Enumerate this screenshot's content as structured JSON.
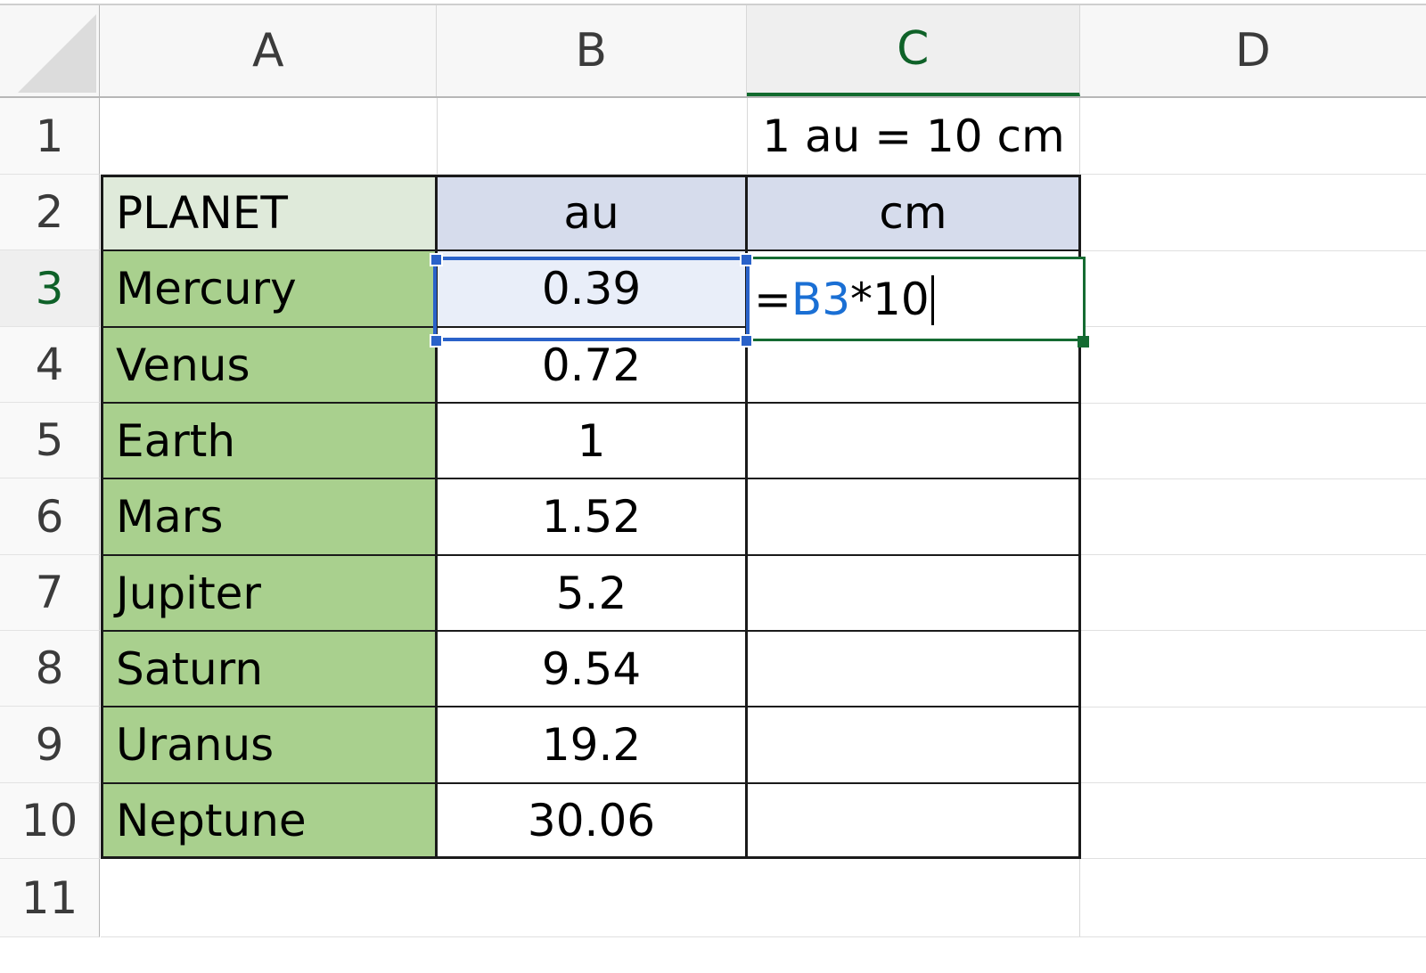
{
  "spreadsheet": {
    "columns": [
      {
        "label": "A",
        "active": false
      },
      {
        "label": "B",
        "active": false
      },
      {
        "label": "C",
        "active": true
      },
      {
        "label": "D",
        "active": false
      }
    ],
    "rows": [
      {
        "label": "1",
        "active": false
      },
      {
        "label": "2",
        "active": false
      },
      {
        "label": "3",
        "active": true
      },
      {
        "label": "4",
        "active": false
      },
      {
        "label": "5",
        "active": false
      },
      {
        "label": "6",
        "active": false
      },
      {
        "label": "7",
        "active": false
      },
      {
        "label": "8",
        "active": false
      },
      {
        "label": "9",
        "active": false
      },
      {
        "label": "10",
        "active": false
      },
      {
        "label": "11",
        "active": false
      }
    ],
    "note": {
      "cell": "C1",
      "text": "1 au = 10 cm"
    },
    "header_row": {
      "row": "2",
      "a": "PLANET",
      "b": "au",
      "c": "cm"
    },
    "active_cell": "C3",
    "referenced_cell": "B3",
    "edit": {
      "cell": "C3",
      "prefix": "=",
      "reference": "B3",
      "suffix": "*10",
      "full_text": "=B3*10"
    },
    "colors": {
      "planet_name_fill": "#a9d08e",
      "planet_header_fill": "#dfeada",
      "unit_header_fill": "#d6dcec",
      "selected_cell_fill": "#e9eef9",
      "reference_border": "#2a62c9",
      "edit_border": "#156b32",
      "reference_text": "#1a6fd4",
      "active_header_text": "#0e6128"
    },
    "data": {
      "columns": [
        "PLANET",
        "au",
        "cm"
      ],
      "rows": [
        {
          "row": "3",
          "planet": "Mercury",
          "au": "0.39",
          "cm": ""
        },
        {
          "row": "4",
          "planet": "Venus",
          "au": "0.72",
          "cm": ""
        },
        {
          "row": "5",
          "planet": "Earth",
          "au": "1",
          "cm": ""
        },
        {
          "row": "6",
          "planet": "Mars",
          "au": "1.52",
          "cm": ""
        },
        {
          "row": "7",
          "planet": "Jupiter",
          "au": "5.2",
          "cm": ""
        },
        {
          "row": "8",
          "planet": "Saturn",
          "au": "9.54",
          "cm": ""
        },
        {
          "row": "9",
          "planet": "Uranus",
          "au": "19.2",
          "cm": ""
        },
        {
          "row": "10",
          "planet": "Neptune",
          "au": "30.06",
          "cm": ""
        }
      ]
    }
  }
}
